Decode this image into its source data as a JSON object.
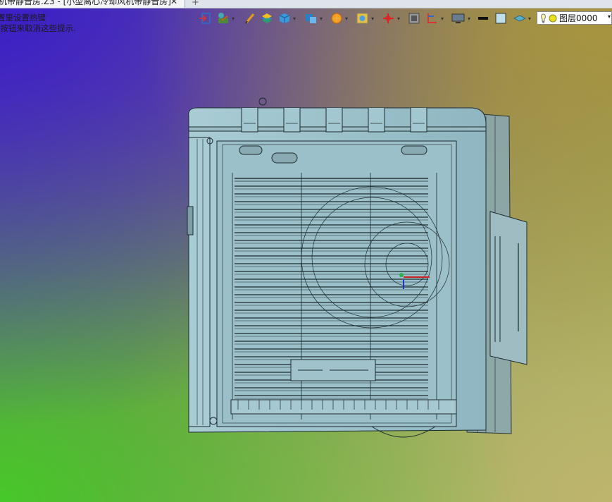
{
  "tab": {
    "title": "机带静音房.Z3 - [小型离心冷却风机带静音房]",
    "close_glyph": "✕",
    "new_tab_glyph": "+"
  },
  "hint": {
    "line1": "置里设置热键",
    "line2": "(按钮来取消这些提示."
  },
  "toolbar": {
    "icons": [
      "exit-sketch-icon",
      "blend-icon",
      "pencil-icon",
      "layers-stack-icon",
      "cube-icon",
      "view-cube-icon",
      "sun-render-icon",
      "target-view-icon",
      "triad-icon",
      "section-view-icon",
      "dimension-icon",
      "monitor-display-icon",
      "line-style-icon",
      "color-square-icon",
      "layer-plane-icon"
    ],
    "dropdown_glyph": "▾"
  },
  "layer": {
    "name": "图层0000",
    "caret": "▾"
  },
  "colors": {
    "model_face": "#9ec2cc",
    "model_edge": "#1c2a30",
    "tab_bg": "#f4f5f7"
  }
}
